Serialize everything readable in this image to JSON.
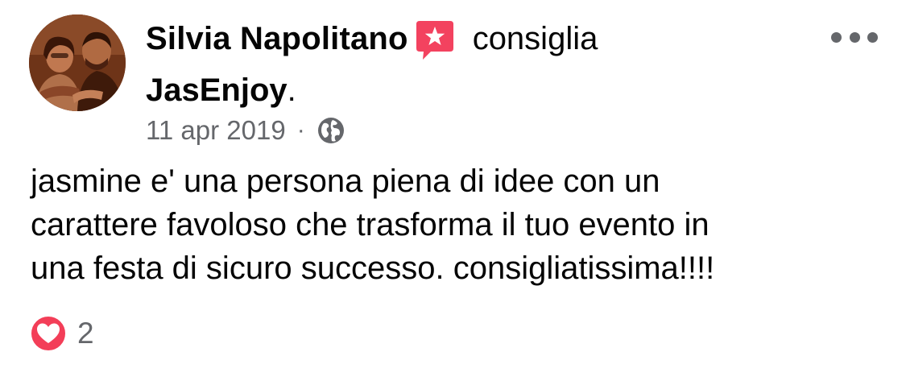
{
  "post": {
    "author": "Silvia Napolitano",
    "verb": "consiglia",
    "page_name": "JasEnjoy",
    "period": ".",
    "date": "11 apr 2019",
    "separator": "·",
    "audience_icon": "globe-icon",
    "recommendation_icon": "recommendation-star-icon",
    "avatar_icon": "profile-photo",
    "menu_icon": "more-options-icon",
    "review_lines": [
      "jasmine e' una persona piena di idee con un",
      "carattere favoloso che trasforma il tuo evento in",
      "una festa di sicuro successo. consigliatissima!!!!"
    ]
  },
  "reactions": {
    "icon": "love-reaction-icon",
    "count": "2"
  },
  "colors": {
    "text_primary": "#050505",
    "text_secondary": "#65676b",
    "recommend_red": "#f3425f",
    "love_red": "#f33e58"
  }
}
